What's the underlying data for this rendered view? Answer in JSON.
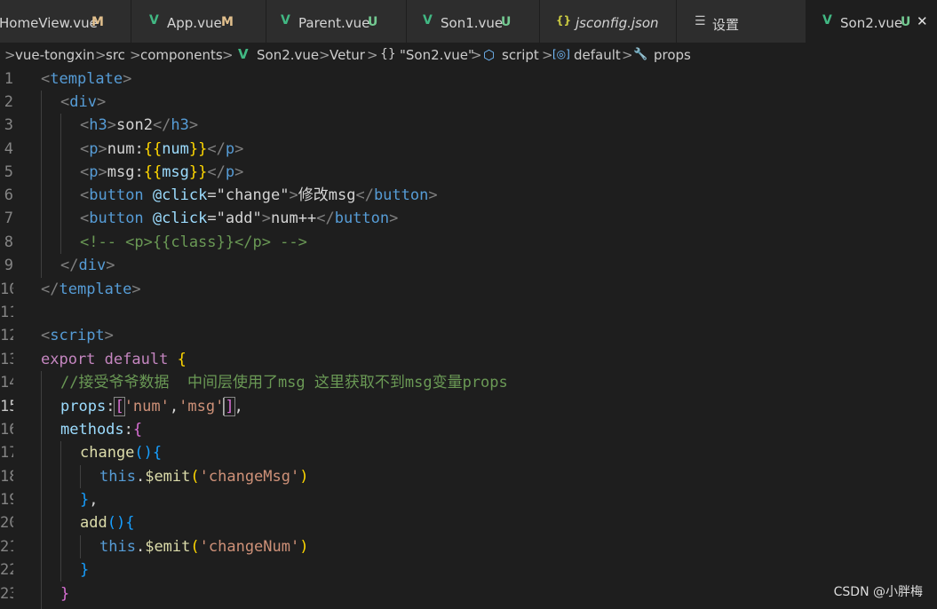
{
  "tabs": [
    {
      "icon": "vue-icon",
      "label": "HomeView.vue",
      "status": "M"
    },
    {
      "icon": "vue-icon",
      "label": "App.vue",
      "status": "M"
    },
    {
      "icon": "vue-icon",
      "label": "Parent.vue",
      "status": "U"
    },
    {
      "icon": "vue-icon",
      "label": "Son1.vue",
      "status": "U"
    },
    {
      "icon": "json-icon",
      "label": "jsconfig.json",
      "status": ""
    },
    {
      "icon": "settings-icon",
      "label": "设置",
      "status": ""
    },
    {
      "icon": "vue-icon",
      "label": "Son2.vue",
      "status": "U",
      "active": true
    }
  ],
  "tab_glyphs": {
    "vue": "V",
    "json": "{}",
    "settings": "☰",
    "close": "✕"
  },
  "breadcrumb": {
    "items": [
      "vue-tongxin",
      "src",
      "components",
      "Son2.vue",
      "Vetur",
      "\"Son2.vue\"",
      "script",
      "default",
      "props"
    ],
    "separator": ">",
    "vue_glyph": "V",
    "obj_glyph": "{}",
    "script_glyph": "⬡",
    "default_glyph": "[◎]",
    "props_glyph": "🔧"
  },
  "line_numbers": [
    "1",
    "2",
    "3",
    "4",
    "5",
    "6",
    "7",
    "8",
    "9",
    "10",
    "11",
    "12",
    "13",
    "14",
    "15",
    "16",
    "17",
    "18",
    "19",
    "20",
    "21",
    "22",
    "23"
  ],
  "code": {
    "l1": [
      "<",
      "template",
      ">"
    ],
    "l2": [
      "<",
      "div",
      ">"
    ],
    "l3": [
      "<",
      "h3",
      ">",
      "son2",
      "</",
      "h3",
      ">"
    ],
    "l4": [
      "<",
      "p",
      ">",
      "num:",
      "{{",
      "num",
      "}}",
      "</",
      "p",
      ">"
    ],
    "l5": [
      "<",
      "p",
      ">",
      "msg:",
      "{{",
      "msg",
      "}}",
      "</",
      "p",
      ">"
    ],
    "l6": [
      "<",
      "button",
      " ",
      "@click",
      "=",
      "\"change\"",
      ">",
      "修改msg",
      "</",
      "button",
      ">"
    ],
    "l7": [
      "<",
      "button",
      " ",
      "@click",
      "=",
      "\"add\"",
      ">",
      "num++",
      "</",
      "button",
      ">"
    ],
    "l8": "<!-- <p>{{class}}</p> -->",
    "l9": [
      "</",
      "div",
      ">"
    ],
    "l10": [
      "</",
      "template",
      ">"
    ],
    "l12": [
      "<",
      "script",
      ">"
    ],
    "l13": [
      "export",
      " ",
      "default",
      " ",
      "{"
    ],
    "l14": "//接受爷爷数据  中间层使用了msg 这里获取不到msg变量props",
    "l15": [
      "props",
      ":",
      "[",
      "'num'",
      ",",
      "'msg'",
      "]",
      ","
    ],
    "l16": [
      "methods",
      ":",
      "{"
    ],
    "l17": [
      "change",
      "()",
      "{"
    ],
    "l18": [
      "this",
      ".",
      "$emit",
      "(",
      "'changeMsg'",
      ")"
    ],
    "l19": [
      "}",
      ","
    ],
    "l20": [
      "add",
      "()",
      "{"
    ],
    "l21": [
      "this",
      ".",
      "$emit",
      "(",
      "'changeNum'",
      ")"
    ],
    "l22": [
      "}"
    ],
    "l23": [
      "}"
    ]
  },
  "watermark": "CSDN @小胖梅",
  "colors": {
    "background": "#1e1e1e",
    "vue_green": "#41b883",
    "modified": "#e2c08d",
    "untracked": "#73c991"
  }
}
